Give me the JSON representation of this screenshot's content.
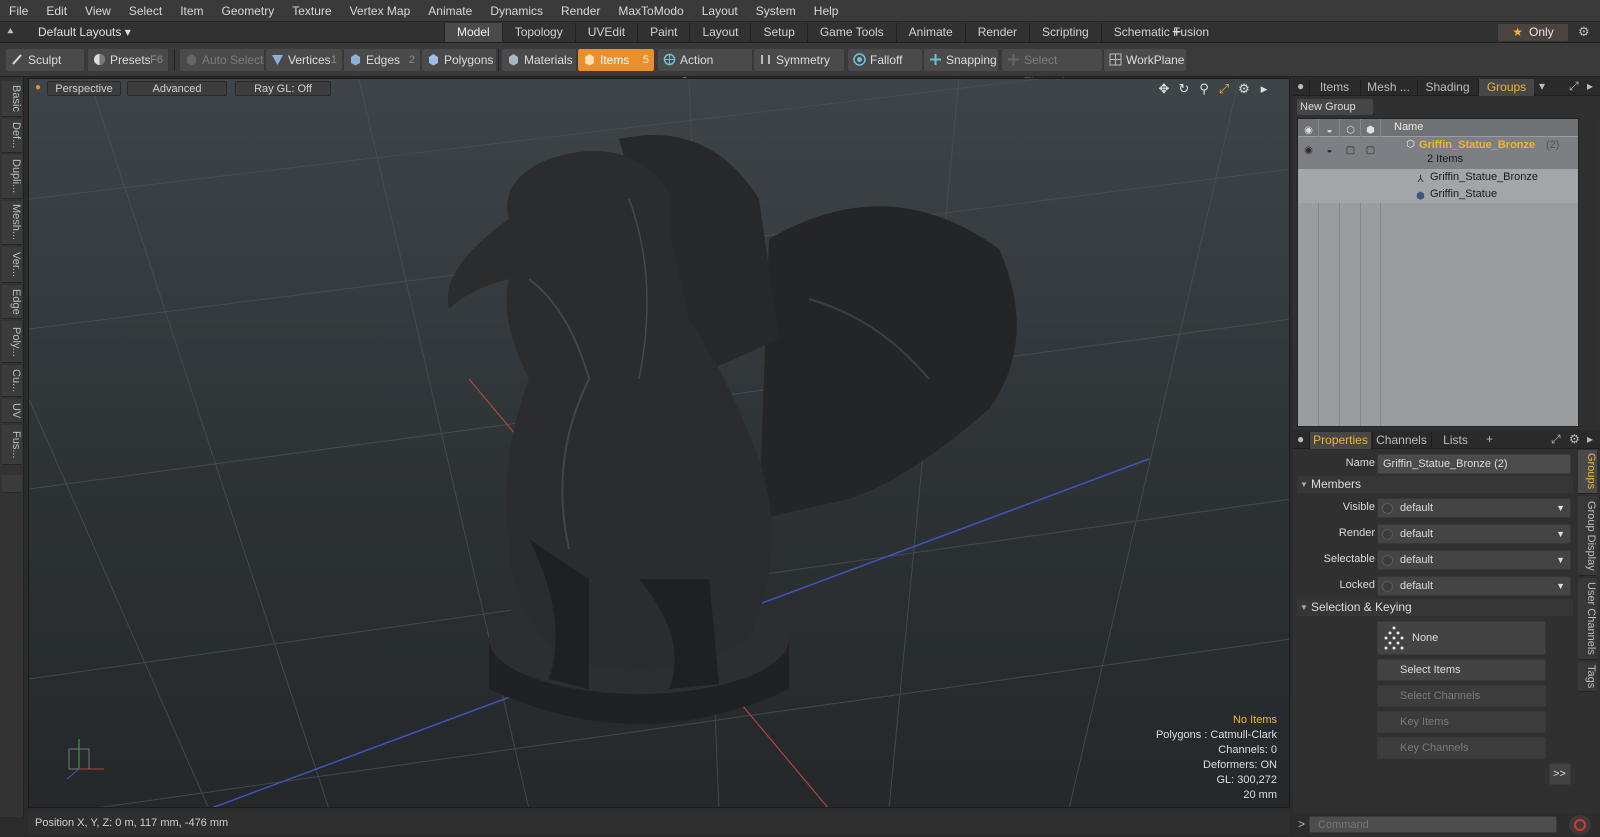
{
  "menu": [
    "File",
    "Edit",
    "View",
    "Select",
    "Item",
    "Geometry",
    "Texture",
    "Vertex Map",
    "Animate",
    "Dynamics",
    "Render",
    "MaxToModo",
    "Layout",
    "System",
    "Help"
  ],
  "layouts": {
    "dropdown": "Default Layouts ▾",
    "tabs": [
      "Model",
      "Topology",
      "UVEdit",
      "Paint",
      "Layout",
      "Setup",
      "Game Tools",
      "Animate",
      "Render",
      "Scripting",
      "Schematic Fusion"
    ],
    "active_tab": "Model",
    "only_label": "Only"
  },
  "toolbar": {
    "sculpt": "Sculpt",
    "presets": "Presets",
    "presets_key": "F6",
    "auto_select": "Auto Select",
    "vertices": "Vertices",
    "vertices_key": "1",
    "edges": "Edges",
    "edges_key": "2",
    "polygons": "Polygons",
    "materials": "Materials",
    "items": "Items",
    "items_key": "5",
    "action_center": "Action Center",
    "symmetry": "Symmetry",
    "falloff": "Falloff",
    "snapping": "Snapping",
    "select_through": "Select Through",
    "workplane": "WorkPlane"
  },
  "left_tabs": [
    "Basic",
    "Def...",
    "Dupli...",
    "Mesh...",
    "Ver...",
    "Edge",
    "Poly...",
    "Cu...",
    "UV",
    "Fus..."
  ],
  "viewport": {
    "view_mode": "Perspective",
    "shading": "Advanced",
    "raygl": "Ray GL: Off",
    "info": {
      "no_items": "No Items",
      "polygons": "Polygons : Catmull-Clark",
      "channels": "Channels: 0",
      "deformers": "Deformers: ON",
      "gl": "GL: 300,272",
      "scale": "20 mm"
    }
  },
  "status": {
    "position": "Position X, Y, Z:   0 m, 117 mm, -476 mm"
  },
  "top_panel": {
    "tabs": [
      "Items",
      "Mesh ...",
      "Shading",
      "Groups"
    ],
    "active": "Groups",
    "new_group": "New Group",
    "col_name": "Name",
    "group_name": "Griffin_Statue_Bronze",
    "group_count": "(2)",
    "group_items": "2 Items",
    "child_1": "Griffin_Statue_Bronze",
    "child_2": "Griffin_Statue"
  },
  "properties": {
    "tabs": [
      "Properties",
      "Channels",
      "Lists"
    ],
    "active": "Properties",
    "name_label": "Name",
    "name_value": "Griffin_Statue_Bronze (2)",
    "members_section": "Members",
    "visible_label": "Visible",
    "visible_value": "default",
    "render_label": "Render",
    "render_value": "default",
    "selectable_label": "Selectable",
    "selectable_value": "default",
    "locked_label": "Locked",
    "locked_value": "default",
    "sel_key_section": "Selection & Keying",
    "none_btn": "None",
    "select_items": "Select Items",
    "select_channels": "Select Channels",
    "key_items": "Key Items",
    "key_channels": "Key Channels",
    "more": ">>",
    "side_tabs": [
      "Groups",
      "Group Display",
      "User Channels",
      "Tags"
    ]
  },
  "command": {
    "placeholder": "Command"
  },
  "colors": {
    "accent": "#f2b233",
    "items_button": "#e98f2c"
  }
}
